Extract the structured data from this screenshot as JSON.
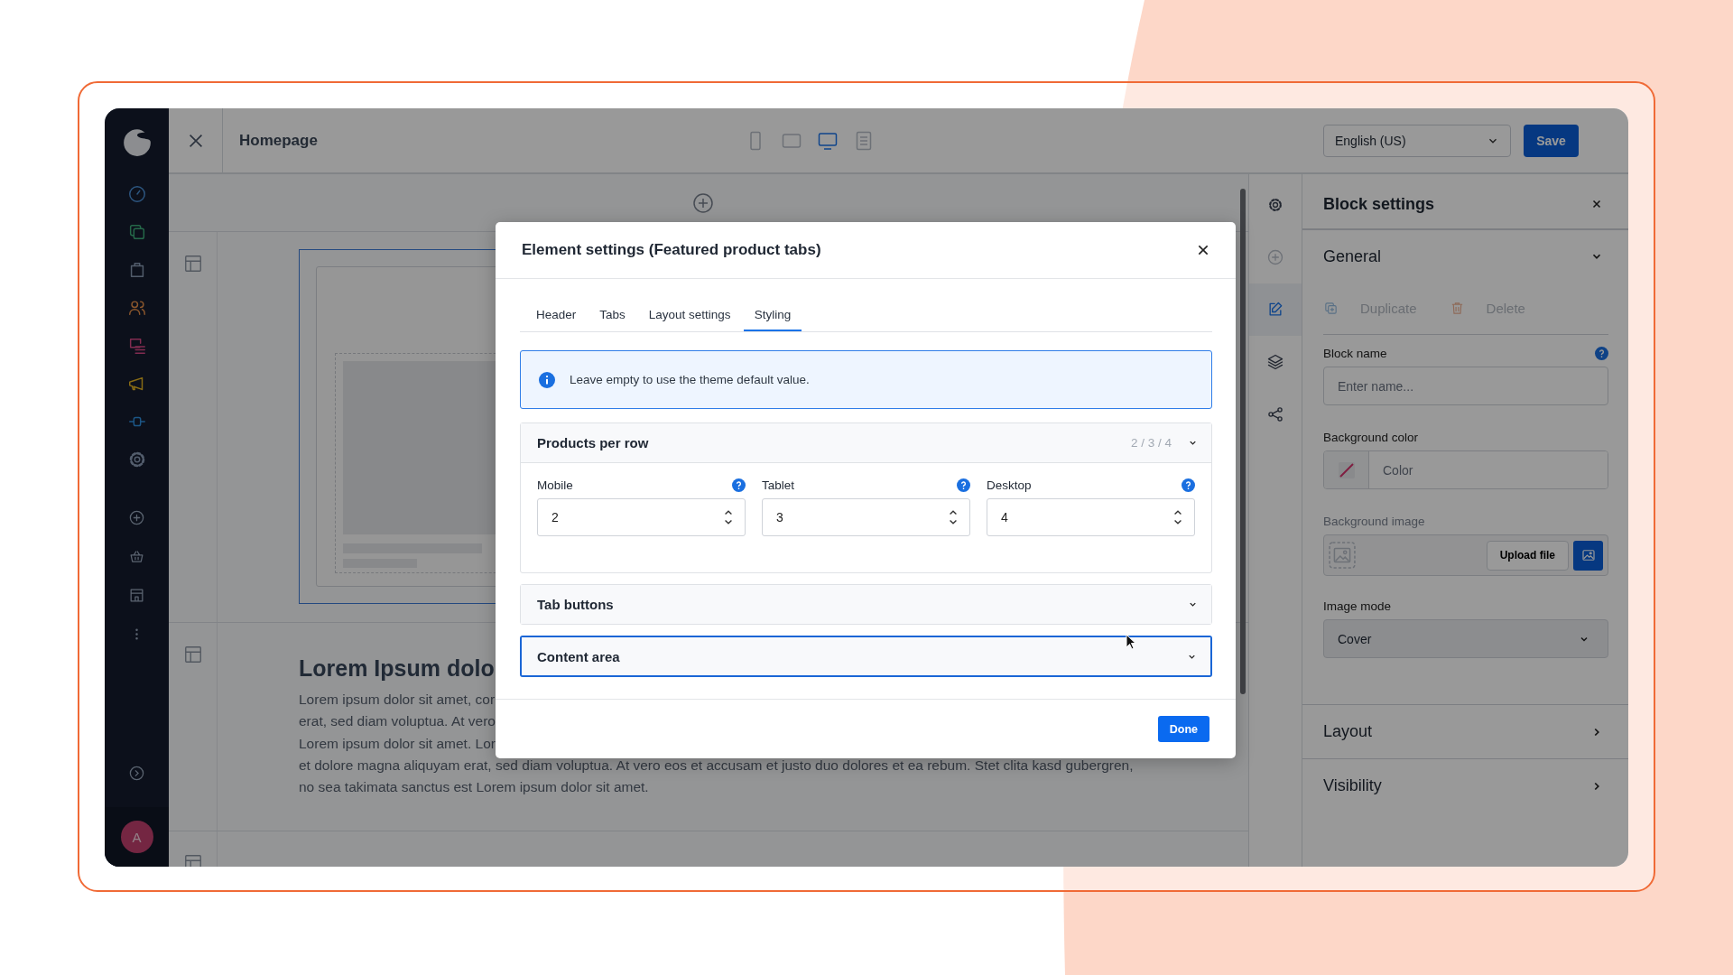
{
  "editor": {
    "title": "Homepage",
    "devices": [
      {
        "selected": false
      },
      {
        "selected": false
      },
      {
        "selected": true
      },
      {
        "selected": false
      }
    ],
    "language": "English (US)",
    "save": "Save",
    "avatar": "A"
  },
  "canvas": {
    "heading": "Lorem Ipsum dolo",
    "lines": [
      "Lorem ipsum dolor sit amet, cor",
      "erat, sed diam voluptua. At vero",
      "Lorem ipsum dolor sit amet. Lor",
      "et dolore magna aliquyam erat, sed diam voluptua. At vero eos et accusam et justo duo dolores et ea rebum. Stet clita kasd gubergren,",
      "no sea takimata sanctus est Lorem ipsum dolor sit amet."
    ]
  },
  "modal": {
    "title": "Element settings (Featured product tabs)",
    "tabs": [
      {
        "label": "Header",
        "selected": false
      },
      {
        "label": "Tabs",
        "selected": false
      },
      {
        "label": "Layout settings",
        "selected": false
      },
      {
        "label": "Styling",
        "selected": true
      }
    ],
    "info": "Leave empty to use the theme default value.",
    "sections": [
      {
        "title": "Products per row",
        "summary": "2 / 3 / 4",
        "expanded": true,
        "focused": false,
        "fields": [
          {
            "label": "Mobile",
            "value": "2"
          },
          {
            "label": "Tablet",
            "value": "3"
          },
          {
            "label": "Desktop",
            "value": "4"
          }
        ]
      },
      {
        "title": "Tab buttons",
        "expanded": false,
        "focused": false
      },
      {
        "title": "Content area",
        "expanded": false,
        "focused": true
      }
    ],
    "done": "Done"
  },
  "right_rail": [
    {
      "selected": false
    },
    {
      "selected": false,
      "disabled": true
    },
    {
      "selected": true
    },
    {
      "selected": false
    },
    {
      "selected": false
    }
  ],
  "block_settings": {
    "title": "Block settings",
    "general": {
      "title": "General",
      "expanded": true
    },
    "duplicate": {
      "label": "Duplicate",
      "disabled": true
    },
    "delete": {
      "label": "Delete",
      "disabled": true
    },
    "block_name": {
      "label": "Block name",
      "placeholder": "Enter name..."
    },
    "background_color": {
      "label": "Background color",
      "placeholder": "Color"
    },
    "background_image": {
      "label": "Background image",
      "upload": "Upload file",
      "disabled": true
    },
    "image_mode": {
      "label": "Image mode",
      "value": "Cover",
      "disabled": true
    },
    "sections": [
      {
        "title": "Layout",
        "expanded": false
      },
      {
        "title": "Visibility",
        "expanded": false
      }
    ]
  }
}
